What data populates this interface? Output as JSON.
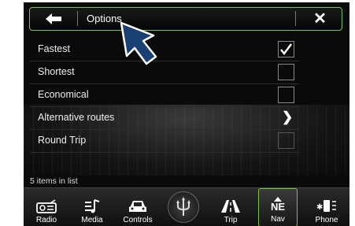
{
  "header": {
    "title": "Options"
  },
  "options": [
    {
      "label": "Fastest",
      "checked": true
    },
    {
      "label": "Shortest",
      "checked": false
    },
    {
      "label": "Economical",
      "checked": false
    },
    {
      "label": "Alternative routes"
    },
    {
      "label": "Round Trip",
      "checked": false
    }
  ],
  "footer": {
    "count_text": "5 items in list"
  },
  "nav": {
    "radio": "Radio",
    "media": "Media",
    "controls": "Controls",
    "trip": "Trip",
    "nav": "Nav",
    "nav_compass": "NE",
    "phone": "Phone"
  },
  "colors": {
    "accent": "#7cc142",
    "background": "#0a0a0a"
  },
  "icons": [
    "back-arrow-icon",
    "close-icon",
    "checkmark-icon",
    "chevron-right-icon",
    "radio-icon",
    "media-icon",
    "car-icon",
    "trident-logo-icon",
    "trip-road-icon",
    "compass-icon",
    "phone-icon",
    "cursor-arrow-icon"
  ]
}
